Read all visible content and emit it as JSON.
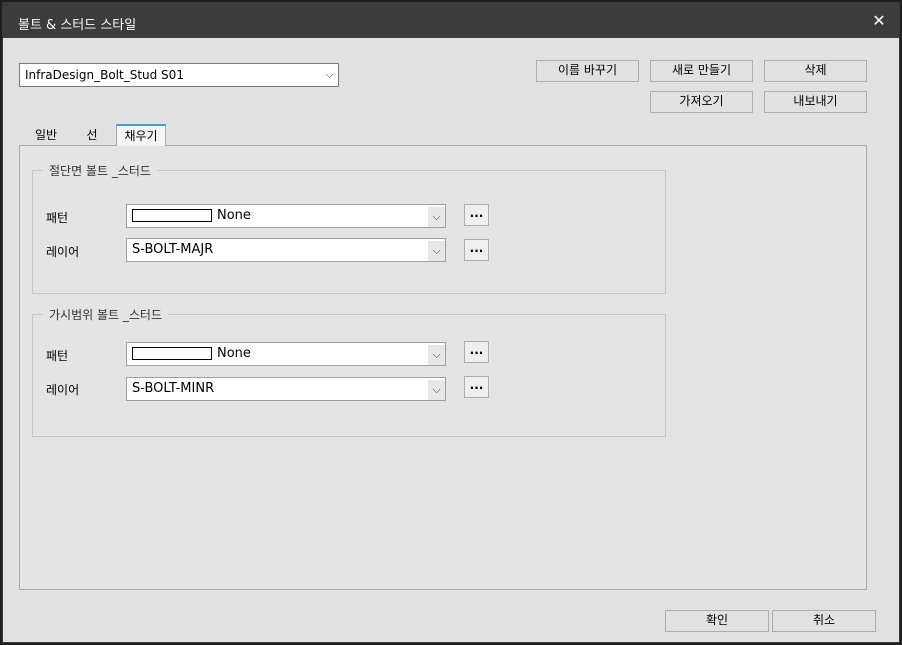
{
  "window": {
    "title": "볼트 & 스터드 스타일",
    "close_glyph": "✕"
  },
  "style_selector": {
    "value": "InfraDesign_Bolt_Stud S01",
    "chevron": "⌵"
  },
  "buttons": {
    "rename": "이름 바꾸기",
    "new": "새로 만들기",
    "delete": "삭제",
    "import": "가져오기",
    "export": "내보내기",
    "ok": "확인",
    "cancel": "취소"
  },
  "tabs": [
    {
      "label": "일반",
      "active": false
    },
    {
      "label": "선",
      "active": false
    },
    {
      "label": "채우기",
      "active": true
    }
  ],
  "groups": [
    {
      "title": "절단면 볼트 _스터드",
      "pattern_label": "패턴",
      "pattern_value": "None",
      "layer_label": "레이어",
      "layer_value": "S-BOLT-MAJR"
    },
    {
      "title": "가시범위 볼트 _스터드",
      "pattern_label": "패턴",
      "pattern_value": "None",
      "layer_label": "레이어",
      "layer_value": "S-BOLT-MINR"
    }
  ],
  "ellipsis_label": "...",
  "colors": {
    "titlebar": "#3c3c3c",
    "dialog_bg": "#e1e1e1",
    "active_tab_accent": "#4c9ae6"
  }
}
